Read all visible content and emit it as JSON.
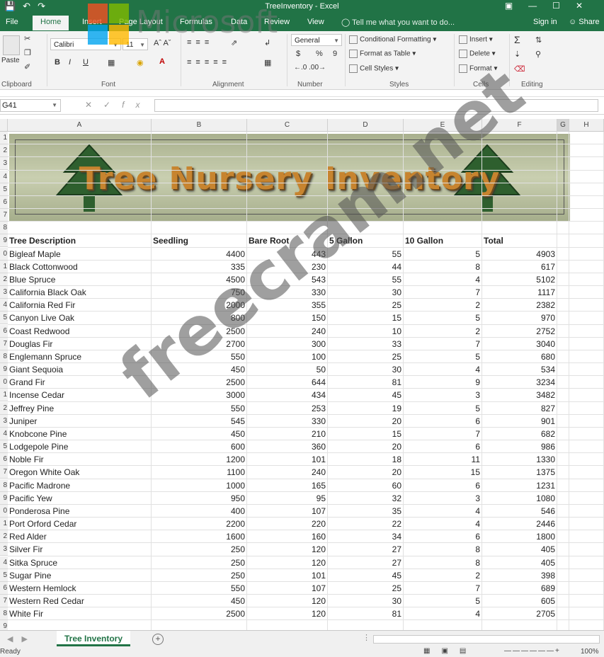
{
  "window": {
    "title": "TreeInventory - Excel"
  },
  "ribbon_tabs": [
    "File",
    "Home",
    "Insert",
    "Page Layout",
    "Formulas",
    "Data",
    "Review",
    "View"
  ],
  "active_tab": "Home",
  "tell_me": "Tell me what you want to do...",
  "sign_in": "Sign in",
  "share": "Share",
  "groups": {
    "clipboard": {
      "label": "Clipboard",
      "paste": "Paste"
    },
    "font": {
      "label": "Font",
      "name": "Calibri",
      "size": "11",
      "bold": "B",
      "italic": "I",
      "underline": "U"
    },
    "alignment": {
      "label": "Alignment"
    },
    "number": {
      "label": "Number",
      "format": "General",
      "currency": "$",
      "percent": "%",
      "comma": "9"
    },
    "styles": {
      "label": "Styles",
      "conditional": "Conditional Formatting",
      "table": "Format as Table",
      "cell": "Cell Styles"
    },
    "cells": {
      "label": "Cells",
      "insert": "Insert",
      "delete": "Delete",
      "format": "Format"
    },
    "editing": {
      "label": "Editing"
    }
  },
  "name_box": "G41",
  "fx": "fx",
  "columns": [
    "A",
    "B",
    "C",
    "D",
    "E",
    "F",
    "G",
    "H"
  ],
  "row_labels": [
    "1",
    "2",
    "3",
    "4",
    "5",
    "6",
    "7",
    "8",
    "9",
    "0",
    "1",
    "2",
    "3",
    "4",
    "5",
    "6",
    "7",
    "8",
    "9",
    "0",
    "1",
    "2",
    "3",
    "4",
    "5",
    "6",
    "7",
    "8",
    "9",
    "0",
    "1",
    "2",
    "3",
    "4",
    "5",
    "6",
    "7",
    "8",
    "9"
  ],
  "banner_title": "Tree Nursery Inventory",
  "headers": [
    "Tree Description",
    "Seedling",
    "Bare Root",
    "5 Gallon",
    "10 Gallon",
    "Total"
  ],
  "rows": [
    [
      "Bigleaf Maple",
      "4400",
      "443",
      "55",
      "5",
      "4903"
    ],
    [
      "Black Cottonwood",
      "335",
      "230",
      "44",
      "8",
      "617"
    ],
    [
      "Blue Spruce",
      "4500",
      "543",
      "55",
      "4",
      "5102"
    ],
    [
      "California Black Oak",
      "750",
      "330",
      "30",
      "7",
      "1117"
    ],
    [
      "California Red Fir",
      "2000",
      "355",
      "25",
      "2",
      "2382"
    ],
    [
      "Canyon Live Oak",
      "800",
      "150",
      "15",
      "5",
      "970"
    ],
    [
      "Coast Redwood",
      "2500",
      "240",
      "10",
      "2",
      "2752"
    ],
    [
      "Douglas Fir",
      "2700",
      "300",
      "33",
      "7",
      "3040"
    ],
    [
      "Englemann Spruce",
      "550",
      "100",
      "25",
      "5",
      "680"
    ],
    [
      "Giant Sequoia",
      "450",
      "50",
      "30",
      "4",
      "534"
    ],
    [
      "Grand Fir",
      "2500",
      "644",
      "81",
      "9",
      "3234"
    ],
    [
      "Incense Cedar",
      "3000",
      "434",
      "45",
      "3",
      "3482"
    ],
    [
      "Jeffrey Pine",
      "550",
      "253",
      "19",
      "5",
      "827"
    ],
    [
      "Juniper",
      "545",
      "330",
      "20",
      "6",
      "901"
    ],
    [
      "Knobcone Pine",
      "450",
      "210",
      "15",
      "7",
      "682"
    ],
    [
      "Lodgepole Pine",
      "600",
      "360",
      "20",
      "6",
      "986"
    ],
    [
      "Noble Fir",
      "1200",
      "101",
      "18",
      "11",
      "1330"
    ],
    [
      "Oregon White Oak",
      "1100",
      "240",
      "20",
      "15",
      "1375"
    ],
    [
      "Pacific Madrone",
      "1000",
      "165",
      "60",
      "6",
      "1231"
    ],
    [
      "Pacific Yew",
      "950",
      "95",
      "32",
      "3",
      "1080"
    ],
    [
      "Ponderosa Pine",
      "400",
      "107",
      "35",
      "4",
      "546"
    ],
    [
      "Port Orford Cedar",
      "2200",
      "220",
      "22",
      "4",
      "2446"
    ],
    [
      "Red Alder",
      "1600",
      "160",
      "34",
      "6",
      "1800"
    ],
    [
      "Silver Fir",
      "250",
      "120",
      "27",
      "8",
      "405"
    ],
    [
      "Sitka Spruce",
      "250",
      "120",
      "27",
      "8",
      "405"
    ],
    [
      "Sugar Pine",
      "250",
      "101",
      "45",
      "2",
      "398"
    ],
    [
      "Western Hemlock",
      "550",
      "107",
      "25",
      "7",
      "689"
    ],
    [
      "Western Red Cedar",
      "450",
      "120",
      "30",
      "5",
      "605"
    ],
    [
      "White Fir",
      "2500",
      "120",
      "81",
      "4",
      "2705"
    ]
  ],
  "sheet_tab": "Tree Inventory",
  "status": {
    "ready": "Ready",
    "zoom": "100%"
  },
  "watermark": {
    "site": "freecram.net",
    "brand": "Microsoft"
  },
  "colors": {
    "excel_green": "#217346",
    "banner_text": "#c7842f"
  }
}
